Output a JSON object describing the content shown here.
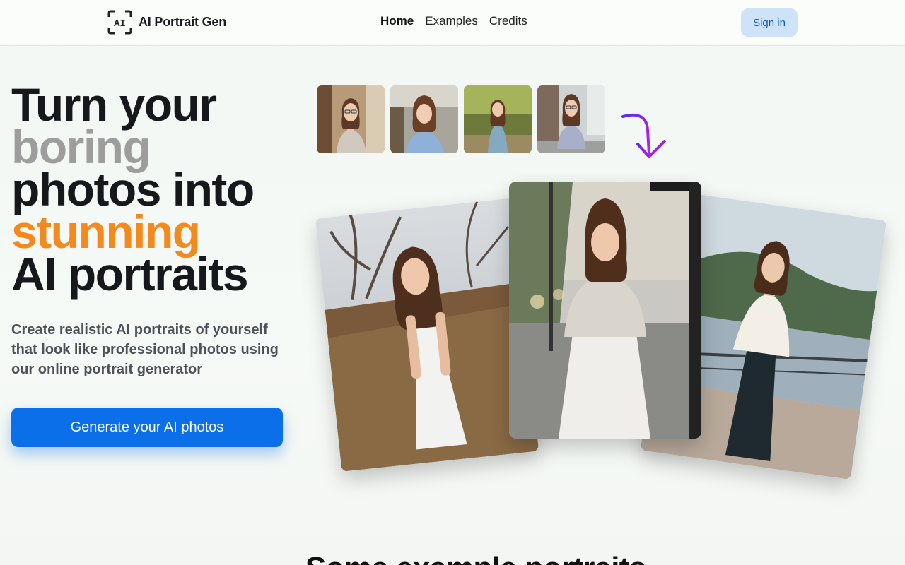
{
  "brand": {
    "logo_text": "AI Portrait Gen",
    "logo_glyph": "AI",
    "icon": "ai-scan-frame-icon"
  },
  "nav": {
    "items": [
      {
        "label": "Home",
        "active": true
      },
      {
        "label": "Examples",
        "active": false
      },
      {
        "label": "Credits",
        "active": false
      }
    ]
  },
  "header": {
    "signin_label": "Sign in"
  },
  "hero": {
    "headline": [
      "Turn your",
      "boring",
      "photos into",
      "stunning",
      "AI portraits"
    ],
    "subtitle": "Create realistic AI portraits of yourself that look like professional photos using our online portrait generator",
    "cta_label": "Generate your AI photos"
  },
  "section": {
    "title": "Some example portraits"
  },
  "colors": {
    "accent": "#0a6fe8",
    "orange": "#f48a1d",
    "gray": "#9d9d9d",
    "arrow_start": "#5a2bea",
    "arrow_end": "#c41de8"
  }
}
